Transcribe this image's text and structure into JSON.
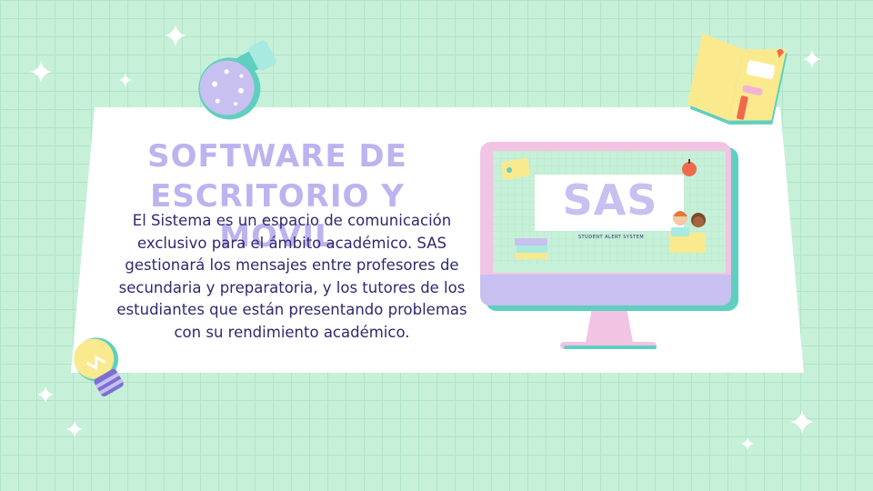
{
  "slide": {
    "title_line1": "SOFTWARE DE",
    "title_line2": "ESCRITORIO Y MÓVIL",
    "body": "El Sistema es un espacio de comunicación exclusivo para el ámbito académico. SAS gestionará los mensajes entre profesores de secundaria y preparatoria, y los tutores de los estudiantes que están presentando problemas con su rendimiento académico."
  },
  "monitor_screen": {
    "logo_text": "SAS",
    "subtitle": "STUDENT ALERT SYSTEM"
  },
  "colors": {
    "background": "#c6f0d8",
    "title": "#bcb3ef",
    "body_text": "#2e2a6e",
    "monitor_frame": "#f1c4e4",
    "monitor_base": "#c8c0f0",
    "accent_teal": "#5fcfc0"
  },
  "decorations": {
    "icons": [
      "potion-flask-icon",
      "open-book-icon",
      "lightbulb-icon",
      "sparkle-icon",
      "computer-monitor-icon"
    ]
  }
}
